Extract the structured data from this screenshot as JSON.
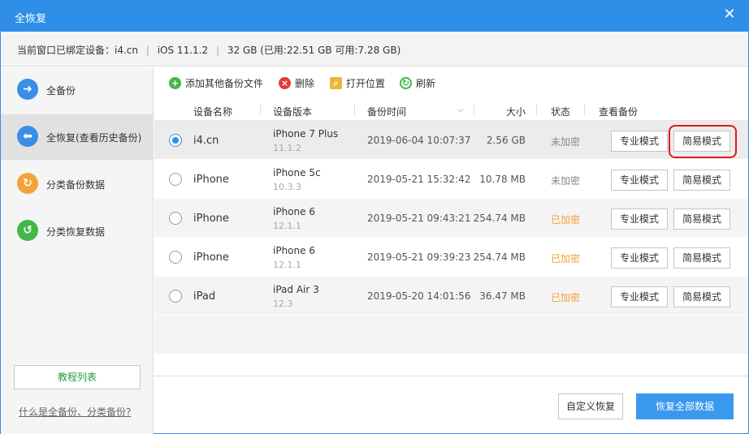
{
  "window": {
    "title": "全恢复",
    "close_icon": "close-icon"
  },
  "device_info": {
    "label": "当前窗口已绑定设备：",
    "device": "i4.cn",
    "ios": "iOS 11.1.2",
    "storage": "32 GB (已用:22.51 GB 可用:7.28 GB)"
  },
  "sidebar": {
    "items": [
      {
        "label": "全备份",
        "icon": "backup-arrow-icon",
        "color": "#3a8ee6"
      },
      {
        "label": "全恢复(查看历史备份)",
        "icon": "restore-arrow-icon",
        "color": "#3a8ee6"
      },
      {
        "label": "分类备份数据",
        "icon": "category-backup-icon",
        "color": "#f2a43a"
      },
      {
        "label": "分类恢复数据",
        "icon": "category-restore-icon",
        "color": "#45b649"
      }
    ],
    "tutorial_label": "教程列表",
    "help_link": "什么是全备份、分类备份?"
  },
  "toolbar": {
    "add_label": "添加其他备份文件",
    "delete_label": "删除",
    "open_label": "打开位置",
    "refresh_label": "刷新"
  },
  "table": {
    "columns": [
      "设备名称",
      "设备版本",
      "备份时间",
      "大小",
      "状态",
      "查看备份"
    ],
    "rows": [
      {
        "name": "i4.cn",
        "model": "iPhone 7 Plus",
        "ios": "11.1.2",
        "time": "2019-06-04 10:07:37",
        "size": "2.56 GB",
        "status": "未加密",
        "encrypted": false,
        "selected": true
      },
      {
        "name": "iPhone",
        "model": "iPhone 5c",
        "ios": "10.3.3",
        "time": "2019-05-21 15:32:42",
        "size": "10.78 MB",
        "status": "未加密",
        "encrypted": false,
        "selected": false
      },
      {
        "name": "iPhone",
        "model": "iPhone 6",
        "ios": "12.1.1",
        "time": "2019-05-21 09:43:21",
        "size": "254.74 MB",
        "status": "已加密",
        "encrypted": true,
        "selected": false
      },
      {
        "name": "iPhone",
        "model": "iPhone 6",
        "ios": "12.1.1",
        "time": "2019-05-21 09:39:23",
        "size": "254.74 MB",
        "status": "已加密",
        "encrypted": true,
        "selected": false
      },
      {
        "name": "iPad",
        "model": "iPad Air 3",
        "ios": "12.3",
        "time": "2019-05-20 14:01:56",
        "size": "36.47 MB",
        "status": "已加密",
        "encrypted": true,
        "selected": false
      }
    ],
    "pro_label": "专业模式",
    "easy_label": "简易模式"
  },
  "footer": {
    "custom_restore_label": "自定义恢复",
    "restore_all_label": "恢复全部数据"
  },
  "colors": {
    "accent": "#2f8fe8",
    "status_plain": "#888888",
    "status_encrypted": "#f0a030",
    "highlight": "#e01b1b"
  }
}
